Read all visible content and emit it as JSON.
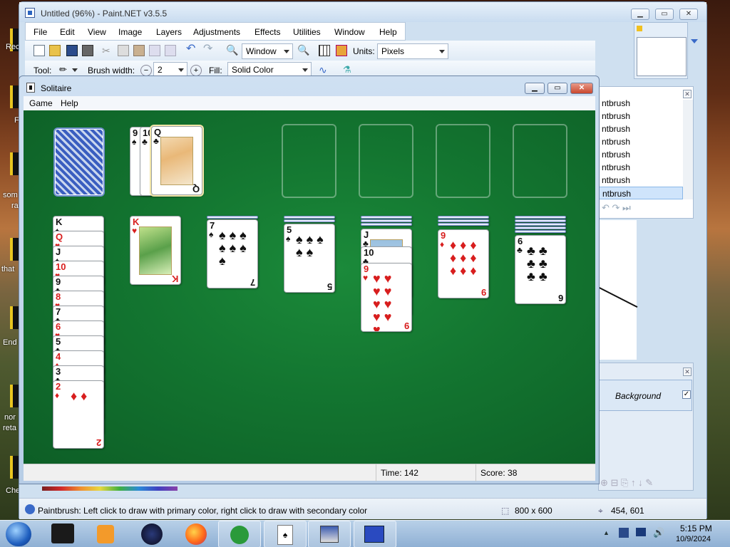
{
  "desktop": {
    "icon_labels": [
      "Rec",
      "F",
      "som",
      "ra",
      "that",
      "End",
      "nor",
      "reta",
      "Che"
    ]
  },
  "paintnet": {
    "title": "Untitled (96%) - Paint.NET v3.5.5",
    "menu": [
      "File",
      "Edit",
      "View",
      "Image",
      "Layers",
      "Adjustments",
      "Effects",
      "Utilities",
      "Window",
      "Help"
    ],
    "zoom_value": "Window",
    "units_label": "Units:",
    "units_value": "Pixels",
    "tool_label": "Tool:",
    "brush_width_label": "Brush width:",
    "brush_width_value": "2",
    "fill_label": "Fill:",
    "fill_value": "Solid Color",
    "history_items": [
      "ntbrush",
      "ntbrush",
      "ntbrush",
      "ntbrush",
      "ntbrush",
      "ntbrush",
      "ntbrush",
      "ntbrush"
    ],
    "layer_name": "Background",
    "layer_checked": "✓",
    "status_text": "Paintbrush: Left click to draw with primary color, right click to draw with secondary color",
    "image_size": "800 x 600",
    "cursor_pos": "454, 601"
  },
  "solitaire": {
    "title": "Solitaire",
    "menu": [
      "Game",
      "Help"
    ],
    "time_label": "Time:",
    "time_value": "142",
    "score_label": "Score:",
    "score_value": "38",
    "waste": [
      {
        "rank": "9",
        "suit": "♠",
        "color": "blk"
      },
      {
        "rank": "10",
        "suit": "♣",
        "color": "blk"
      },
      {
        "rank": "Q",
        "suit": "♣",
        "color": "blk"
      }
    ],
    "col1": [
      {
        "rank": "K",
        "suit": "♠",
        "color": "blk"
      },
      {
        "rank": "Q",
        "suit": "♥",
        "color": "red"
      },
      {
        "rank": "J",
        "suit": "♠",
        "color": "blk"
      },
      {
        "rank": "10",
        "suit": "♥",
        "color": "red"
      },
      {
        "rank": "9",
        "suit": "♣",
        "color": "blk"
      },
      {
        "rank": "8",
        "suit": "♥",
        "color": "red"
      },
      {
        "rank": "7",
        "suit": "♣",
        "color": "blk"
      },
      {
        "rank": "6",
        "suit": "♥",
        "color": "red"
      },
      {
        "rank": "5",
        "suit": "♣",
        "color": "blk"
      },
      {
        "rank": "4",
        "suit": "♦",
        "color": "red"
      },
      {
        "rank": "3",
        "suit": "♣",
        "color": "blk"
      },
      {
        "rank": "2",
        "suit": "♦",
        "color": "red"
      }
    ],
    "col2_top": {
      "rank": "K",
      "suit": "♥",
      "color": "red"
    },
    "col3_top": {
      "rank": "7",
      "suit": "♠",
      "color": "blk"
    },
    "col4_top": {
      "rank": "5",
      "suit": "♠",
      "color": "blk"
    },
    "col5": [
      {
        "rank": "J",
        "suit": "♣",
        "color": "blk"
      },
      {
        "rank": "10",
        "suit": "♣",
        "color": "blk"
      },
      {
        "rank": "9",
        "suit": "♥",
        "color": "red"
      }
    ],
    "col6_top": {
      "rank": "9",
      "suit": "♦",
      "color": "red"
    },
    "col7_top": {
      "rank": "6",
      "suit": "♣",
      "color": "blk"
    }
  },
  "taskbar": {
    "time": "5:15 PM",
    "date": "10/9/2024"
  }
}
